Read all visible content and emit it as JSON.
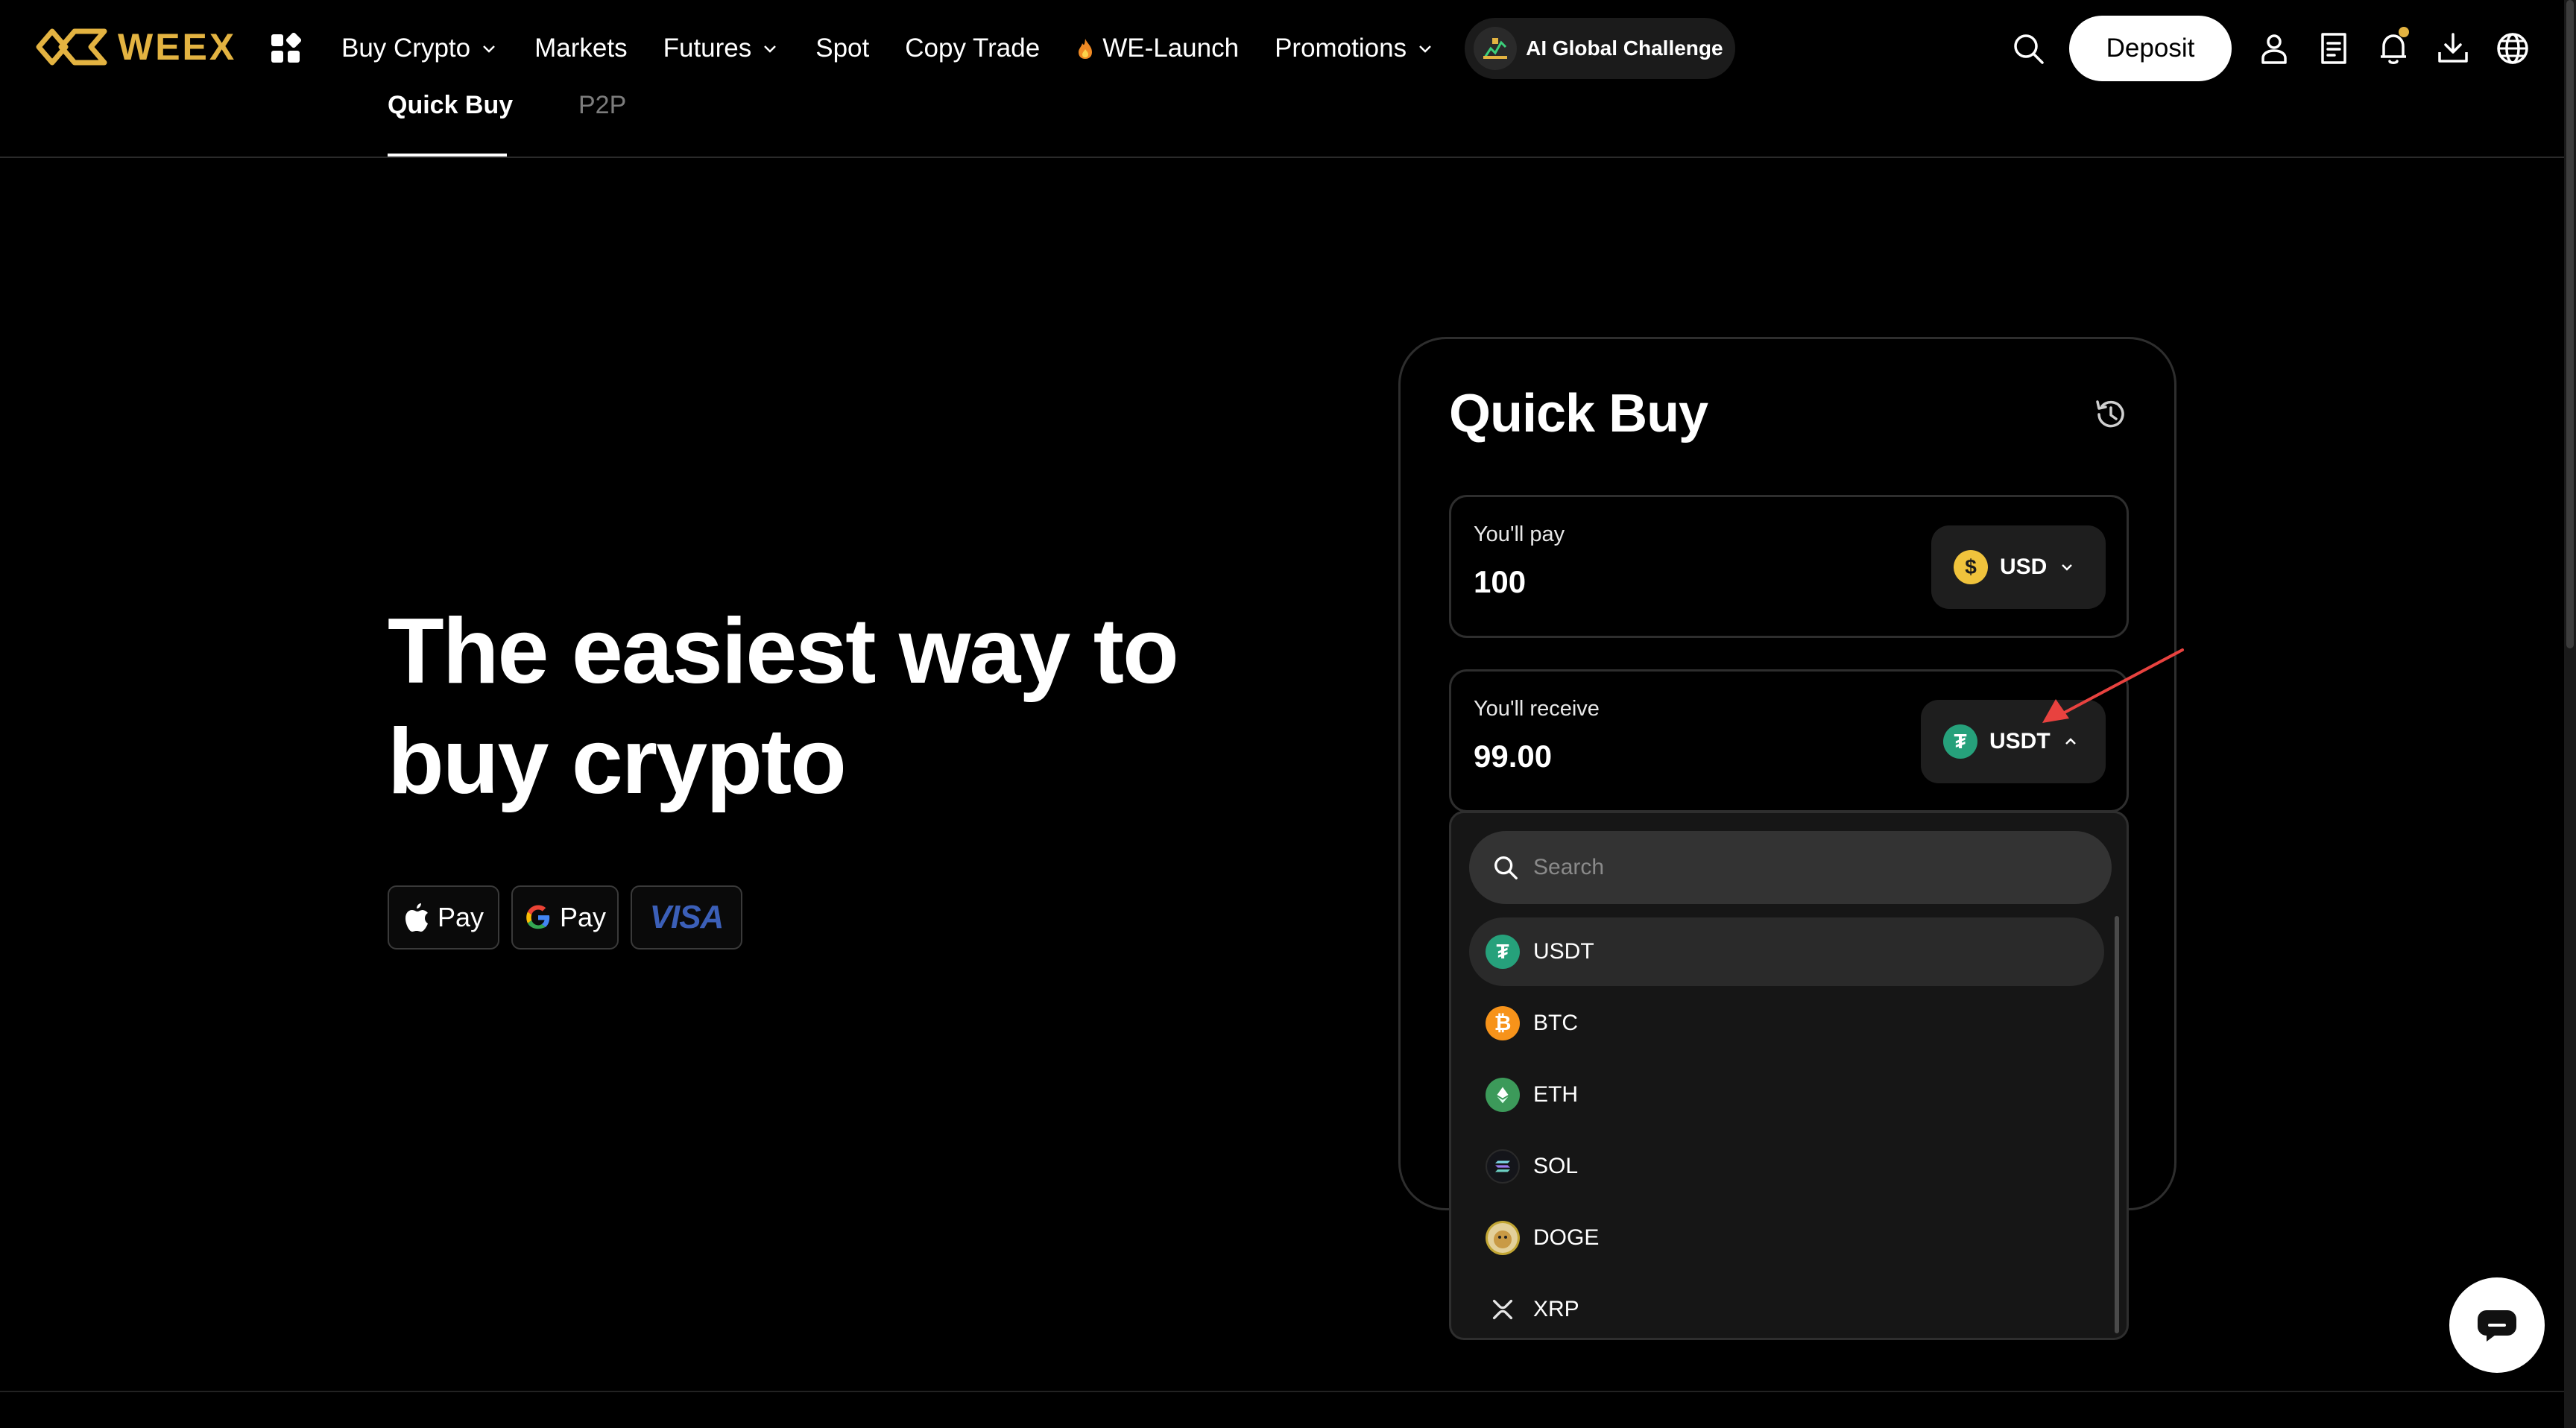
{
  "brand": {
    "name": "WEEX",
    "color": "#e3b341"
  },
  "nav": {
    "items": [
      {
        "label": "Buy Crypto",
        "has_dropdown": true
      },
      {
        "label": "Markets",
        "has_dropdown": false
      },
      {
        "label": "Futures",
        "has_dropdown": true
      },
      {
        "label": "Spot",
        "has_dropdown": false
      },
      {
        "label": "Copy Trade",
        "has_dropdown": false
      },
      {
        "label": "WE-Launch",
        "has_dropdown": false,
        "icon": "flame-icon"
      },
      {
        "label": "Promotions",
        "has_dropdown": true
      }
    ],
    "ai_challenge": "AI Global Challenge",
    "deposit": "Deposit",
    "icons": [
      "search-icon",
      "user-icon",
      "orders-icon",
      "bell-icon",
      "download-icon",
      "globe-icon"
    ]
  },
  "subtabs": [
    {
      "label": "Quick Buy",
      "active": true
    },
    {
      "label": "P2P",
      "active": false
    }
  ],
  "hero": {
    "title_line1": "The easiest way to",
    "title_line2": "buy crypto",
    "payments": [
      {
        "label": "Pay",
        "icon": "apple-icon"
      },
      {
        "label": "Pay",
        "icon": "google-icon"
      },
      {
        "label": "VISA",
        "icon": "visa-logo"
      }
    ]
  },
  "quick_buy": {
    "title": "Quick Buy",
    "pay": {
      "label": "You'll pay",
      "value": "100",
      "currency": "USD"
    },
    "receive": {
      "label": "You'll receive",
      "value": "99.00",
      "currency": "USDT"
    },
    "dropdown": {
      "search_placeholder": "Search",
      "items": [
        {
          "symbol": "USDT",
          "color": "#26a17b",
          "selected": true
        },
        {
          "symbol": "BTC",
          "color": "#f7931a",
          "selected": false
        },
        {
          "symbol": "ETH",
          "color": "#3c9a5a",
          "selected": false
        },
        {
          "symbol": "SOL",
          "color": "#14151a",
          "selected": false
        },
        {
          "symbol": "DOGE",
          "color": "#c2a633",
          "selected": false
        },
        {
          "symbol": "XRP",
          "color": "#161616",
          "selected": false
        }
      ]
    }
  },
  "colors": {
    "background": "#000000",
    "card_border": "#2e2e2e",
    "annotation_arrow": "#e8423f"
  }
}
